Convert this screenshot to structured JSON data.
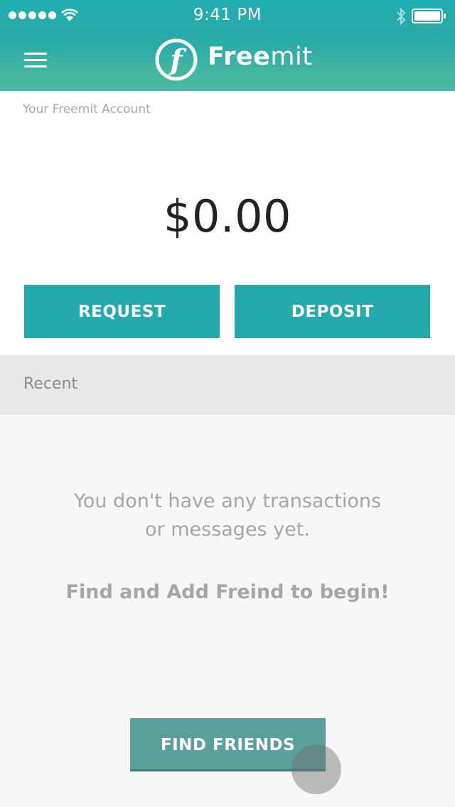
{
  "status_bar": {
    "time": "9:41 PM",
    "signal_icon": "signal-dots-icon",
    "wifi_icon": "wifi-icon",
    "bluetooth_icon": "bluetooth-icon",
    "battery_icon": "battery-icon"
  },
  "header": {
    "menu_icon": "hamburger-menu-icon",
    "logo_letter": "f",
    "brand_bold": "Free",
    "brand_light": "mit",
    "colors": {
      "header_start": "#22aeb0",
      "header_end": "#4bbba0"
    }
  },
  "account": {
    "label": "Your Freemit Account",
    "balance": "$0.00",
    "request_label": "REQUEST",
    "deposit_label": "DEPOSIT",
    "button_color": "#22aaad"
  },
  "recent": {
    "label": "Recent"
  },
  "empty_state": {
    "message_line1": "You don't have any transactions",
    "message_line2": "or messages yet.",
    "cta": "Find and Add Freind to begin!",
    "find_friends_label": "FIND FRIENDS",
    "find_button_color": "#5a9f9c"
  }
}
